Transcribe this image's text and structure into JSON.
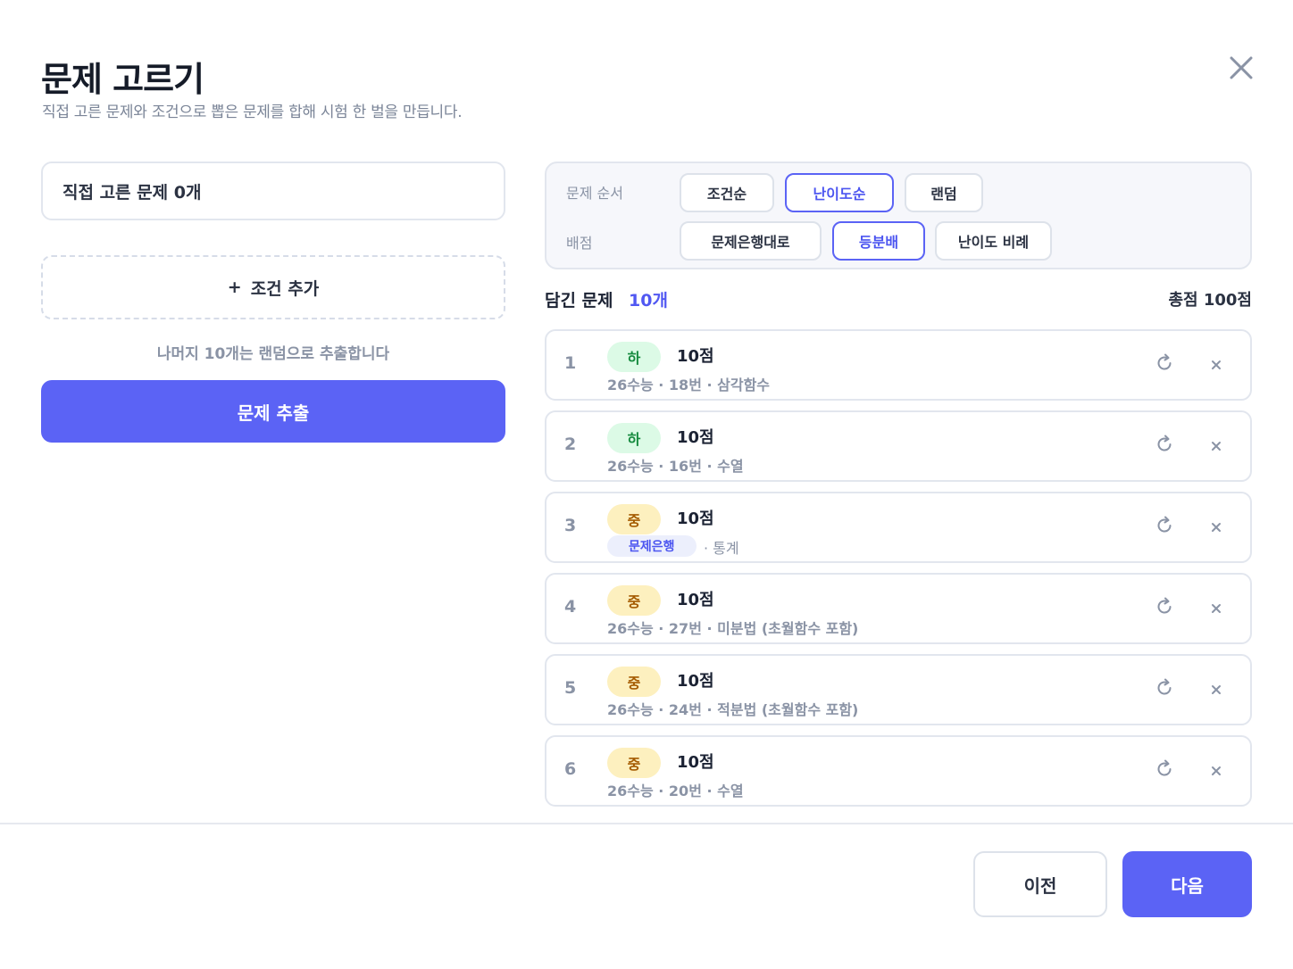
{
  "dialog": {
    "title": "문제 고르기",
    "subtitle": "직접 고른 문제와 조건으로 뽑은 문제를 합해 시험 한 벌을 만듭니다.",
    "close_icon": "close-icon"
  },
  "left": {
    "picked_label": "직접 고른 문제 0개",
    "add_condition_plus": "+",
    "add_condition_label": "조건 추가",
    "remain_note": "나머지 10개는 랜덤으로 추출합니다",
    "extract_label": "문제 추출"
  },
  "options": {
    "order_label": "문제 순서",
    "order_options": [
      "조건순",
      "난이도순",
      "랜덤"
    ],
    "order_selected": "난이도순",
    "score_label": "배점",
    "score_options": [
      "문제은행대로",
      "등분배",
      "난이도 비례"
    ],
    "score_selected": "등분배"
  },
  "list": {
    "label": "담긴 문제",
    "count": "10개",
    "total": "총점 100점",
    "items": [
      {
        "num": "1",
        "level": "하",
        "score": "10점",
        "meta": "26수능 · 18번 · 삼각함수"
      },
      {
        "num": "2",
        "level": "하",
        "score": "10점",
        "meta": "26수능 · 16번 · 수열"
      },
      {
        "num": "3",
        "level": "중",
        "score": "10점",
        "bank": "문제은행",
        "topic": "· 통계"
      },
      {
        "num": "4",
        "level": "중",
        "score": "10점",
        "meta": "26수능 · 27번 · 미분법 (초월함수 포함)"
      },
      {
        "num": "5",
        "level": "중",
        "score": "10점",
        "meta": "26수능 · 24번 · 적분법 (초월함수 포함)"
      },
      {
        "num": "6",
        "level": "중",
        "score": "10점",
        "meta": "26수능 · 20번 · 수열"
      }
    ]
  },
  "footer": {
    "prev_label": "이전",
    "next_label": "다음"
  },
  "colors": {
    "accent": "#5b63f5",
    "level_easy_bg": "#dcfae6",
    "level_easy_text": "#158a3e",
    "level_mid_bg": "#fdf0bf",
    "level_mid_text": "#a45a00"
  }
}
